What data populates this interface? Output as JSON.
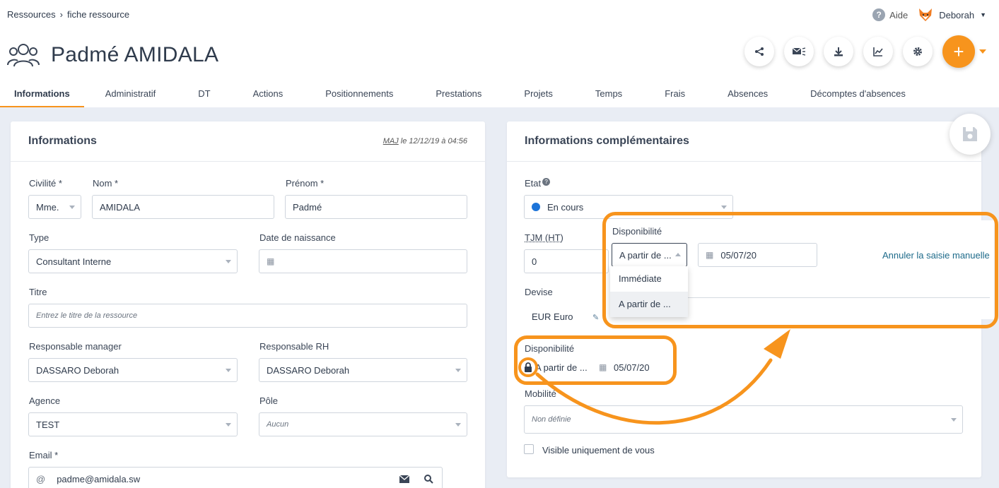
{
  "breadcrumb": {
    "root": "Ressources",
    "separator": "›",
    "current": "fiche ressource"
  },
  "userbar": {
    "help_label": "Aide",
    "user_name": "Deborah"
  },
  "page": {
    "title": "Padmé AMIDALA"
  },
  "tabs": [
    {
      "label": "Informations"
    },
    {
      "label": "Administratif"
    },
    {
      "label": "DT"
    },
    {
      "label": "Actions"
    },
    {
      "label": "Positionnements"
    },
    {
      "label": "Prestations"
    },
    {
      "label": "Projets"
    },
    {
      "label": "Temps"
    },
    {
      "label": "Frais"
    },
    {
      "label": "Absences"
    },
    {
      "label": "Décomptes d'absences"
    }
  ],
  "info": {
    "title": "Informations",
    "maj_label": "MAJ",
    "maj_date": " le 12/12/19 à 04:56",
    "civilite_label": "Civilité *",
    "civilite_value": "Mme.",
    "nom_label": "Nom *",
    "nom_value": "AMIDALA",
    "prenom_label": "Prénom *",
    "prenom_value": "Padmé",
    "type_label": "Type",
    "type_value": "Consultant Interne",
    "naissance_label": "Date de naissance",
    "titre_label": "Titre",
    "titre_placeholder": "Entrez le titre de la ressource",
    "manager_label": "Responsable manager",
    "manager_value": "DASSARO Deborah",
    "rh_label": "Responsable RH",
    "rh_value": "DASSARO Deborah",
    "agence_label": "Agence",
    "agence_value": "TEST",
    "pole_label": "Pôle",
    "pole_value": "Aucun",
    "email_label": "Email *",
    "email_prefix": "@",
    "email_value": "padme@amidala.sw"
  },
  "complement": {
    "title": "Informations complémentaires",
    "etat_label": "Etat",
    "etat_value": "En cours",
    "tjm_label": "TJM (HT)",
    "tjm_value": "0",
    "devise_label": "Devise",
    "devise_value": "EUR Euro",
    "dispo_label": "Disponibilité",
    "dispo_mode": "A partir de ...",
    "dispo_date": "05/07/20",
    "mobilite_label": "Mobilité",
    "mobilite_value": "Non définie",
    "visible_label": "Visible uniquement de vous"
  },
  "popup": {
    "dispo_label": "Disponibilité",
    "mode_value": "A partir de ...",
    "date_value": "05/07/20",
    "cancel_link": "Annuler la saisie manuelle",
    "options": [
      "Immédiate",
      "A partir de ..."
    ]
  },
  "colors": {
    "accent": "#f7941d",
    "status_dot": "#1c74d9",
    "link": "#1d6a8a"
  }
}
